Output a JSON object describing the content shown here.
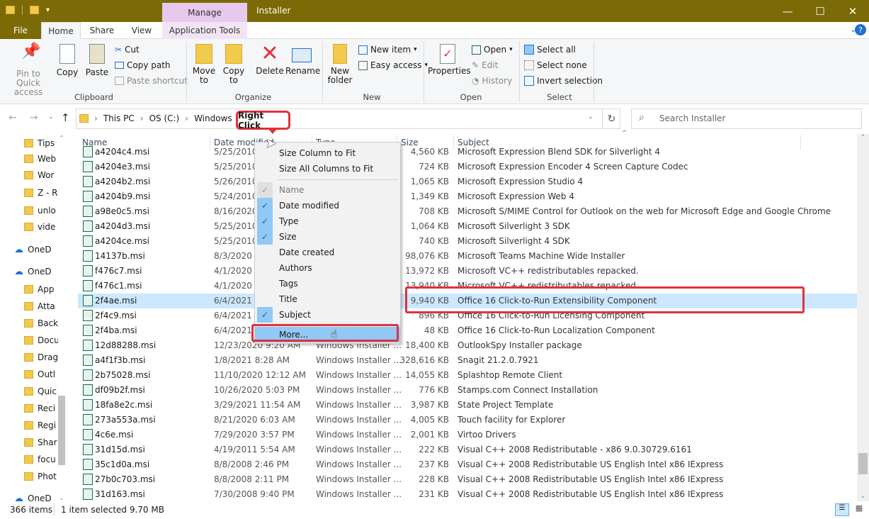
{
  "window": {
    "title": "Installer",
    "manage_tab": "Manage",
    "minimize": "—",
    "maximize": "☐",
    "close": "✕"
  },
  "tabs": [
    "File",
    "Home",
    "Share",
    "View",
    "Application Tools"
  ],
  "ribbon": {
    "clipboard": {
      "pin": "Pin to Quick\naccess",
      "copy": "Copy",
      "paste": "Paste",
      "cut": "Cut",
      "copy_path": "Copy path",
      "paste_shortcut": "Paste shortcut",
      "label": "Clipboard"
    },
    "organize": {
      "move_to": "Move\nto",
      "copy_to": "Copy\nto",
      "delete": "Delete",
      "rename": "Rename",
      "label": "Organize"
    },
    "new": {
      "new_folder": "New\nfolder",
      "new_item": "New item",
      "easy_access": "Easy access",
      "label": "New"
    },
    "open": {
      "properties": "Properties",
      "open": "Open",
      "edit": "Edit",
      "history": "History",
      "label": "Open"
    },
    "select": {
      "select_all": "Select all",
      "select_none": "Select none",
      "invert": "Invert selection",
      "label": "Select"
    }
  },
  "address": {
    "crumbs": [
      "This PC",
      "OS (C:)",
      "Windows"
    ],
    "search_placeholder": "Search Installer",
    "callout": "Right Click"
  },
  "nav": [
    "Tips",
    "Web",
    "Wor",
    "Z - R",
    "unlo",
    "vide",
    "OneD",
    "OneD",
    "App",
    "Atta",
    "Back",
    "Docu",
    "Drag",
    "Outl",
    "Quic",
    "Reci",
    "Regi",
    "Shar",
    "focu",
    "Phot",
    "OneD"
  ],
  "columns": {
    "name": "Name",
    "date": "Date modified",
    "type": "Type",
    "size": "Size",
    "subject": "Subject"
  },
  "files": [
    {
      "name": "a4204c4.msi",
      "date": "5/25/2010 1",
      "type": "",
      "size": "4,560 KB",
      "subject": "Microsoft Expression Blend SDK for Silverlight 4"
    },
    {
      "name": "a4204e3.msi",
      "date": "5/25/2010 1",
      "type": "",
      "size": "724 KB",
      "subject": "Microsoft Expression Encoder 4 Screen Capture Codec"
    },
    {
      "name": "a4204b2.msi",
      "date": "5/26/2010 1",
      "type": "",
      "size": "1,065 KB",
      "subject": "Microsoft Expression Studio 4"
    },
    {
      "name": "a4204b9.msi",
      "date": "5/24/2010 1",
      "type": "",
      "size": "1,349 KB",
      "subject": "Microsoft Expression Web 4"
    },
    {
      "name": "a98e0c5.msi",
      "date": "8/16/2020 1",
      "type": "",
      "size": "708 KB",
      "subject": "Microsoft S/MIME Control for Outlook on the web for Microsoft Edge and Google Chrome"
    },
    {
      "name": "a4204d3.msi",
      "date": "5/25/2010 1",
      "type": "",
      "size": "1,064 KB",
      "subject": "Microsoft Silverlight 3 SDK"
    },
    {
      "name": "a4204ce.msi",
      "date": "5/25/2010 1",
      "type": "",
      "size": "740 KB",
      "subject": "Microsoft Silverlight 4 SDK"
    },
    {
      "name": "14137b.msi",
      "date": "8/3/2020 4:",
      "type": "",
      "size": "98,076 KB",
      "subject": "Microsoft Teams Machine Wide Installer"
    },
    {
      "name": "f476c7.msi",
      "date": "4/1/2020 3:",
      "type": "",
      "size": "13,972 KB",
      "subject": "Microsoft VC++ redistributables repacked."
    },
    {
      "name": "f476c1.msi",
      "date": "4/1/2020 3:",
      "type": "",
      "size": "13,940 KB",
      "subject": "Microsoft VC++ redistributables repacked."
    },
    {
      "name": "2f4ae.msi",
      "date": "6/4/2021 2:",
      "type": "",
      "size": "9,940 KB",
      "subject": "Office 16 Click-to-Run Extensibility Component"
    },
    {
      "name": "2f4c9.msi",
      "date": "6/4/2021 2:",
      "type": "",
      "size": "896 KB",
      "subject": "Office 16 Click-to-Run Licensing Component"
    },
    {
      "name": "2f4ba.msi",
      "date": "6/4/2021 2:",
      "type": "",
      "size": "48 KB",
      "subject": "Office 16 Click-to-Run Localization Component"
    },
    {
      "name": "12d88288.msi",
      "date": "12/23/2020 9:20 AM",
      "type": "Windows Installer ...",
      "size": "18,400 KB",
      "subject": "OutlookSpy Installer package"
    },
    {
      "name": "a4f1f3b.msi",
      "date": "1/8/2021 8:28 AM",
      "type": "Windows Installer ...",
      "size": "328,616 KB",
      "subject": "Snagit 21.2.0.7921"
    },
    {
      "name": "2b75028.msi",
      "date": "11/10/2020 12:12 AM",
      "type": "Windows Installer ...",
      "size": "14,055 KB",
      "subject": "Splashtop Remote Client"
    },
    {
      "name": "df09b2f.msi",
      "date": "10/26/2020 5:03 PM",
      "type": "Windows Installer ...",
      "size": "776 KB",
      "subject": "Stamps.com  Connect Installation"
    },
    {
      "name": "18fa8e2c.msi",
      "date": "3/29/2021 11:54 AM",
      "type": "Windows Installer ...",
      "size": "3,987 KB",
      "subject": "State Project Template"
    },
    {
      "name": "273a553a.msi",
      "date": "8/21/2020 6:03 AM",
      "type": "Windows Installer ...",
      "size": "4,005 KB",
      "subject": "Touch facility for Explorer"
    },
    {
      "name": "4c6e.msi",
      "date": "7/29/2020 3:57 PM",
      "type": "Windows Installer ...",
      "size": "2,001 KB",
      "subject": "Virtoo Drivers"
    },
    {
      "name": "31d15d.msi",
      "date": "4/19/2011 5:54 AM",
      "type": "Windows Installer ...",
      "size": "222 KB",
      "subject": "Visual C++ 2008 Redistributable - x86 9.0.30729.6161"
    },
    {
      "name": "35c1d0a.msi",
      "date": "8/8/2008 2:46 PM",
      "type": "Windows Installer ...",
      "size": "237 KB",
      "subject": "Visual C++ 2008 Redistributable US English Intel x86 IExpress"
    },
    {
      "name": "27b0c703.msi",
      "date": "8/8/2008 2:11 PM",
      "type": "Windows Installer ...",
      "size": "228 KB",
      "subject": "Visual C++ 2008 Redistributable US English Intel x86 IExpress"
    },
    {
      "name": "31d163.msi",
      "date": "7/30/2008 9:40 PM",
      "type": "Windows Installer ...",
      "size": "231 KB",
      "subject": "Visual C++ 2008 Redistributable US English Intel x86 IExpress"
    }
  ],
  "context_menu": {
    "size_col": "Size Column to Fit",
    "size_all": "Size All Columns to Fit",
    "items": [
      {
        "label": "Name",
        "checked": true,
        "disabled": true
      },
      {
        "label": "Date modified",
        "checked": true
      },
      {
        "label": "Type",
        "checked": true
      },
      {
        "label": "Size",
        "checked": true
      },
      {
        "label": "Date created",
        "checked": false
      },
      {
        "label": "Authors",
        "checked": false
      },
      {
        "label": "Tags",
        "checked": false
      },
      {
        "label": "Title",
        "checked": false
      },
      {
        "label": "Subject",
        "checked": true
      }
    ],
    "more": "More..."
  },
  "status": {
    "count": "366 items",
    "selected": "1 item selected  9.70 MB"
  },
  "colors": {
    "titlebar": "#7b6a05",
    "manage": "#e6c9ec",
    "selection": "#cce8ff",
    "highlight": "#e2313b",
    "check": "#90c8f6"
  }
}
